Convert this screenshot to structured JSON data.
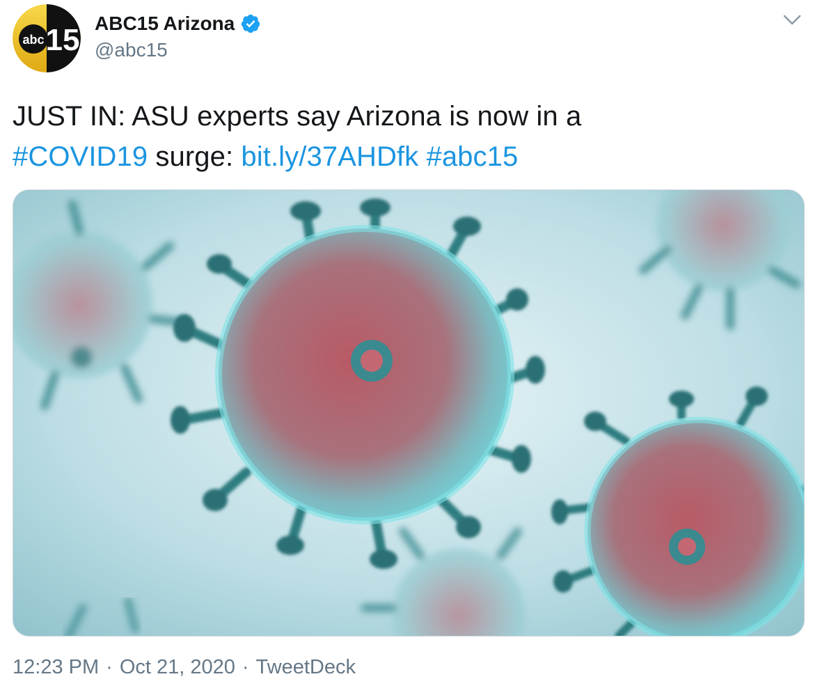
{
  "author": {
    "display_name": "ABC15 Arizona",
    "handle": "@abc15",
    "verified": true,
    "avatar_text_left": "abc",
    "avatar_text_right": "15"
  },
  "tweet": {
    "line1": "JUST IN: ASU experts say Arizona is now in a",
    "hashtag_covid": "#COVID19",
    "text_surge": " surge: ",
    "link": "bit.ly/37AHDfk",
    "hashtag_abc15": "#abc15"
  },
  "meta": {
    "time": "12:23 PM",
    "separator": "·",
    "date": "Oct 21, 2020",
    "source": "TweetDeck"
  },
  "icons": {
    "verified": "verified-badge-icon",
    "caret": "chevron-down-icon"
  },
  "colors": {
    "link": "#1b95e0",
    "verified": "#1da1f2",
    "meta_text": "#657786"
  }
}
